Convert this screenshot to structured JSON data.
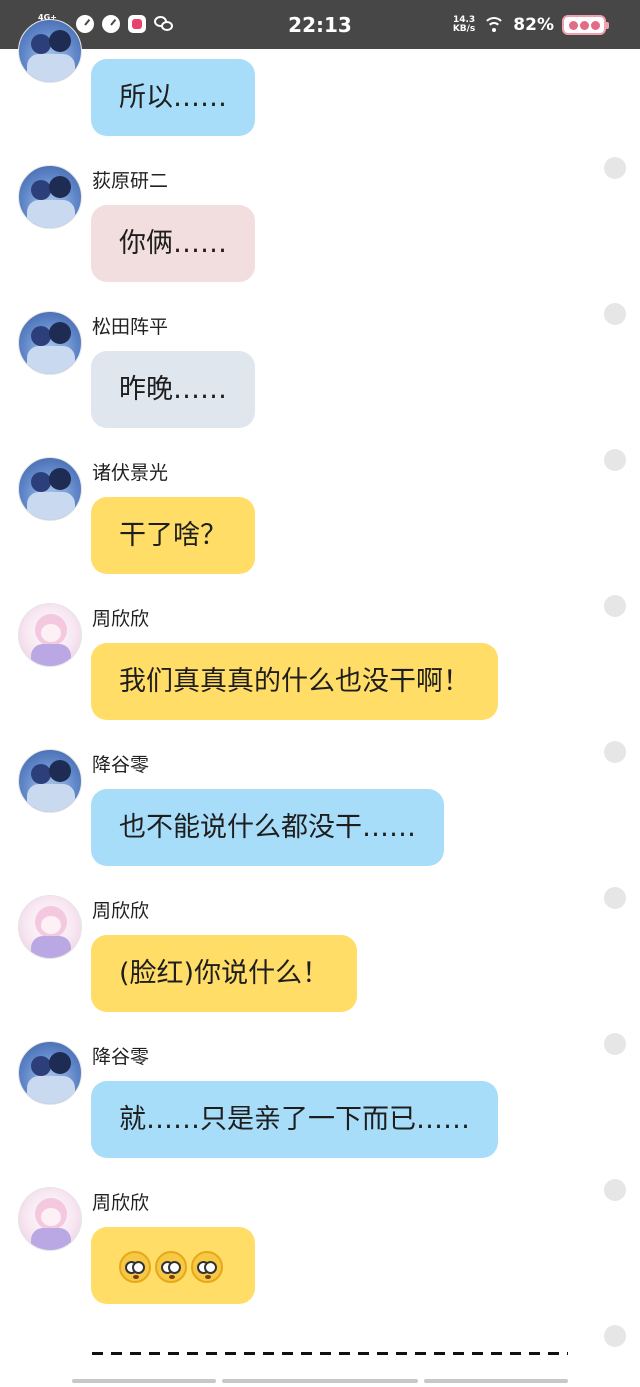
{
  "status_bar": {
    "network": "4G+ HD",
    "time": "22:13",
    "speed_value": "14.3",
    "speed_unit": "KB/s",
    "battery": "82%"
  },
  "messages": [
    {
      "sender": "",
      "text": "所以……",
      "avatar": "officer-avatar",
      "bubble_color": "#a7ddf9"
    },
    {
      "sender": "荻原研二",
      "text": "你俩……",
      "avatar": "officer-avatar",
      "bubble_color": "#f2dede"
    },
    {
      "sender": "松田阵平",
      "text": "昨晚……",
      "avatar": "officer-avatar",
      "bubble_color": "#dfe6ee"
    },
    {
      "sender": "诸伏景光",
      "text": "干了啥？",
      "avatar": "officer-avatar",
      "bubble_color": "#ffdd67"
    },
    {
      "sender": "周欣欣",
      "text": "我们真真真的什么也没干啊！",
      "avatar": "girl-avatar",
      "bubble_color": "#ffdd67"
    },
    {
      "sender": "降谷零",
      "text": "也不能说什么都没干……",
      "avatar": "officer-avatar",
      "bubble_color": "#a7ddf9"
    },
    {
      "sender": "周欣欣",
      "text": "(脸红)你说什么！",
      "avatar": "girl-avatar",
      "bubble_color": "#ffdd67"
    },
    {
      "sender": "降谷零",
      "text": "就……只是亲了一下而已……",
      "avatar": "officer-avatar",
      "bubble_color": "#a7ddf9"
    },
    {
      "sender": "周欣欣",
      "text": "",
      "emoji": [
        "flushed-face",
        "flushed-face",
        "flushed-face"
      ],
      "avatar": "girl-avatar",
      "bubble_color": "#ffdd67"
    }
  ]
}
